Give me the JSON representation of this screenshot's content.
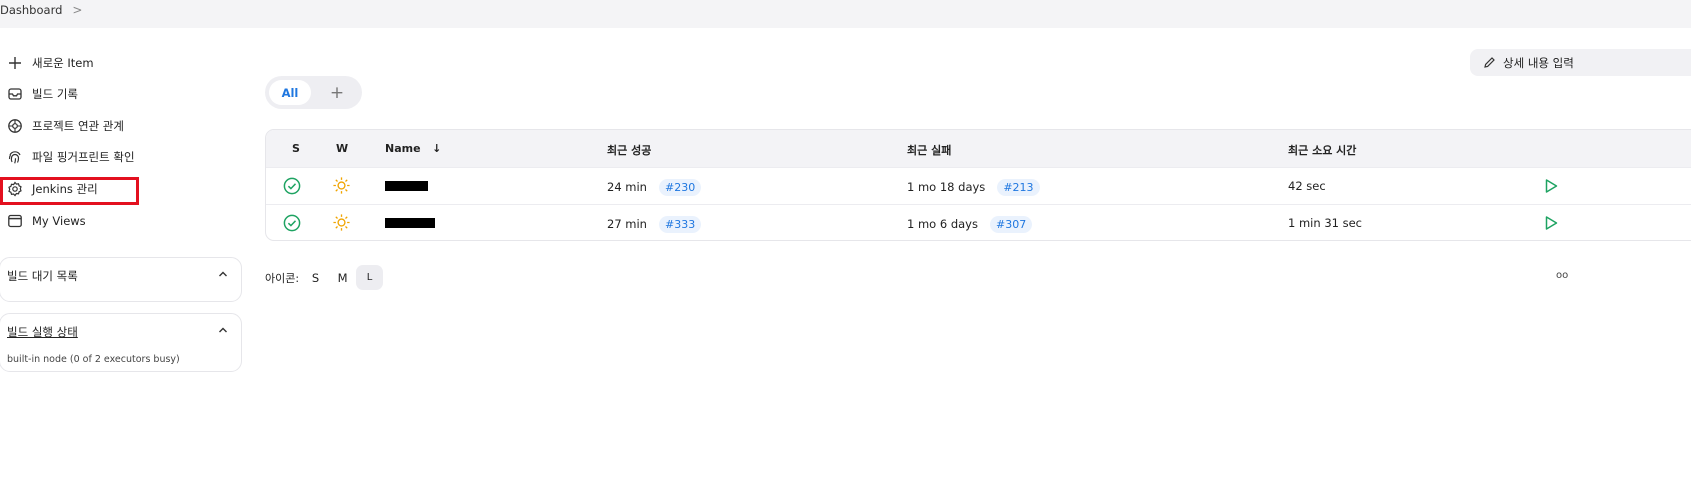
{
  "breadcrumb": {
    "home": "Dashboard",
    "separator": ">"
  },
  "sidebar": {
    "items": [
      {
        "label": "새로운 Item",
        "icon": "plus-icon"
      },
      {
        "label": "빌드 기록",
        "icon": "inbox-icon"
      },
      {
        "label": "프로젝트 연관 관계",
        "icon": "relationship-icon"
      },
      {
        "label": "파일 핑거프린트 확인",
        "icon": "fingerprint-icon"
      },
      {
        "label": "Jenkins 관리",
        "icon": "gear-icon"
      },
      {
        "label": "My Views",
        "icon": "window-icon"
      }
    ],
    "build_queue": {
      "title": "빌드 대기 목록"
    },
    "executors": {
      "title": "빌드 실행 상태",
      "node": "built-in node (0 of 2 executors busy)"
    }
  },
  "view_tabs": {
    "active": "All",
    "add": "+"
  },
  "description_button": {
    "label": "상세 내용 입력"
  },
  "table": {
    "headers": {
      "status": "S",
      "weather": "W",
      "name": "Name",
      "sort_arrow": "↓",
      "last_success": "최근 성공",
      "last_failure": "최근 실패",
      "last_duration": "최근 소요 시간"
    },
    "rows": [
      {
        "status": "success-icon",
        "weather": "sun-icon",
        "last_success": "24 min",
        "success_build": "#230",
        "last_failure": "1 mo 18 days",
        "failure_build": "#213",
        "duration": "42 sec"
      },
      {
        "status": "success-icon",
        "weather": "sun-icon",
        "last_success": "27 min",
        "success_build": "#333",
        "last_failure": "1 mo 6 days",
        "failure_build": "#307",
        "duration": "1 min 31 sec"
      }
    ]
  },
  "icon_size": {
    "label": "아이콘:",
    "options": [
      "S",
      "M",
      "L"
    ],
    "selected": "L"
  },
  "legend": {
    "label": "oo"
  },
  "colors": {
    "accent": "#1f77e0",
    "success": "#1ea362",
    "weather": "#f0a400",
    "highlight": "#e3101f"
  }
}
